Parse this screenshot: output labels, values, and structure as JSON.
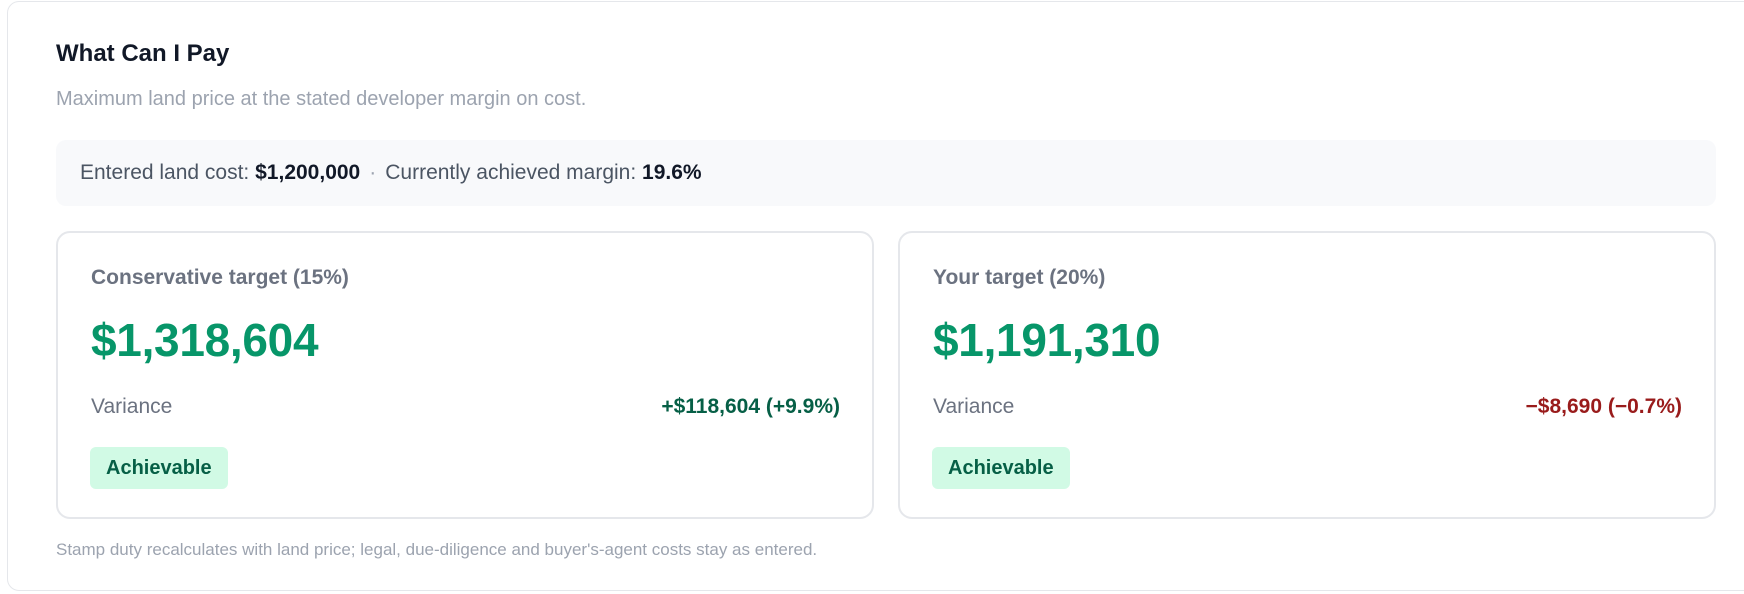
{
  "header": {
    "title": "What Can I Pay",
    "subtitle": "Maximum land price at the stated developer margin on cost."
  },
  "summary": {
    "land_cost_label": "Entered land cost:",
    "land_cost_value": "$1,200,000",
    "separator": "·",
    "margin_label": "Currently achieved margin:",
    "margin_value": "19.6%"
  },
  "cards": [
    {
      "title": "Conservative target (15%)",
      "amount": "$1,318,604",
      "variance_label": "Variance",
      "variance_value": "+$118,604 (+9.9%)",
      "variance_color": "#065f46",
      "badge": "Achievable"
    },
    {
      "title": "Your target (20%)",
      "amount": "$1,191,310",
      "variance_label": "Variance",
      "variance_value": "−$8,690 (−0.7%)",
      "variance_color": "#991b1b",
      "badge": "Achievable"
    }
  ],
  "footnote": "Stamp duty recalculates with land price; legal, due-diligence and buyer's-agent costs stay as entered.",
  "colors": {
    "amount": "#079669",
    "badge_bg": "#d1fae5",
    "badge_text": "#065f46",
    "summary_bg": "#f8f9fb"
  }
}
